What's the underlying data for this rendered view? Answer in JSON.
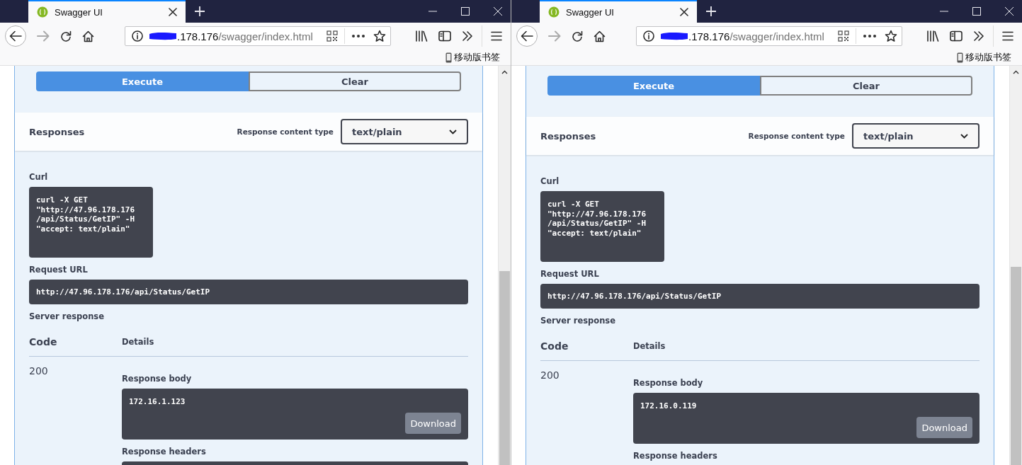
{
  "windows": [
    {
      "tab": {
        "title": "Swagger UI",
        "selected": true
      },
      "address": {
        "host": ".178.176",
        "path": "/swagger/index.html"
      },
      "bookmarks_label": "移动版书签",
      "swagger": {
        "execute_label": "Execute",
        "clear_label": "Clear",
        "responses_title": "Responses",
        "content_type_label": "Response content type",
        "content_type_value": "text/plain",
        "curl_label": "Curl",
        "curl_command": "curl -X GET\n\"http://47.96.178.176\n/api/Status/GetIP\" -H\n\"accept: text/plain\"",
        "request_url_label": "Request URL",
        "request_url": "http://47.96.178.176/api/Status/GetIP",
        "server_response_label": "Server response",
        "columns": [
          "Code",
          "Details"
        ],
        "response": {
          "code": "200",
          "body_label": "Response body",
          "body": "172.16.1.123",
          "download_label": "Download",
          "headers_label": "Response headers"
        }
      }
    },
    {
      "tab": {
        "title": "Swagger UI",
        "selected": true
      },
      "address": {
        "host": ".178.176",
        "path": "/swagger/index.html"
      },
      "bookmarks_label": "移动版书签",
      "swagger": {
        "execute_label": "Execute",
        "clear_label": "Clear",
        "responses_title": "Responses",
        "content_type_label": "Response content type",
        "content_type_value": "text/plain",
        "curl_label": "Curl",
        "curl_command": "curl -X GET\n\"http://47.96.178.176\n/api/Status/GetIP\" -H\n\"accept: text/plain\"",
        "request_url_label": "Request URL",
        "request_url": "http://47.96.178.176/api/Status/GetIP",
        "server_response_label": "Server response",
        "columns": [
          "Code",
          "Details"
        ],
        "response": {
          "code": "200",
          "body_label": "Response body",
          "body": "172.16.0.119",
          "download_label": "Download",
          "headers_label": "Response headers"
        }
      }
    }
  ]
}
